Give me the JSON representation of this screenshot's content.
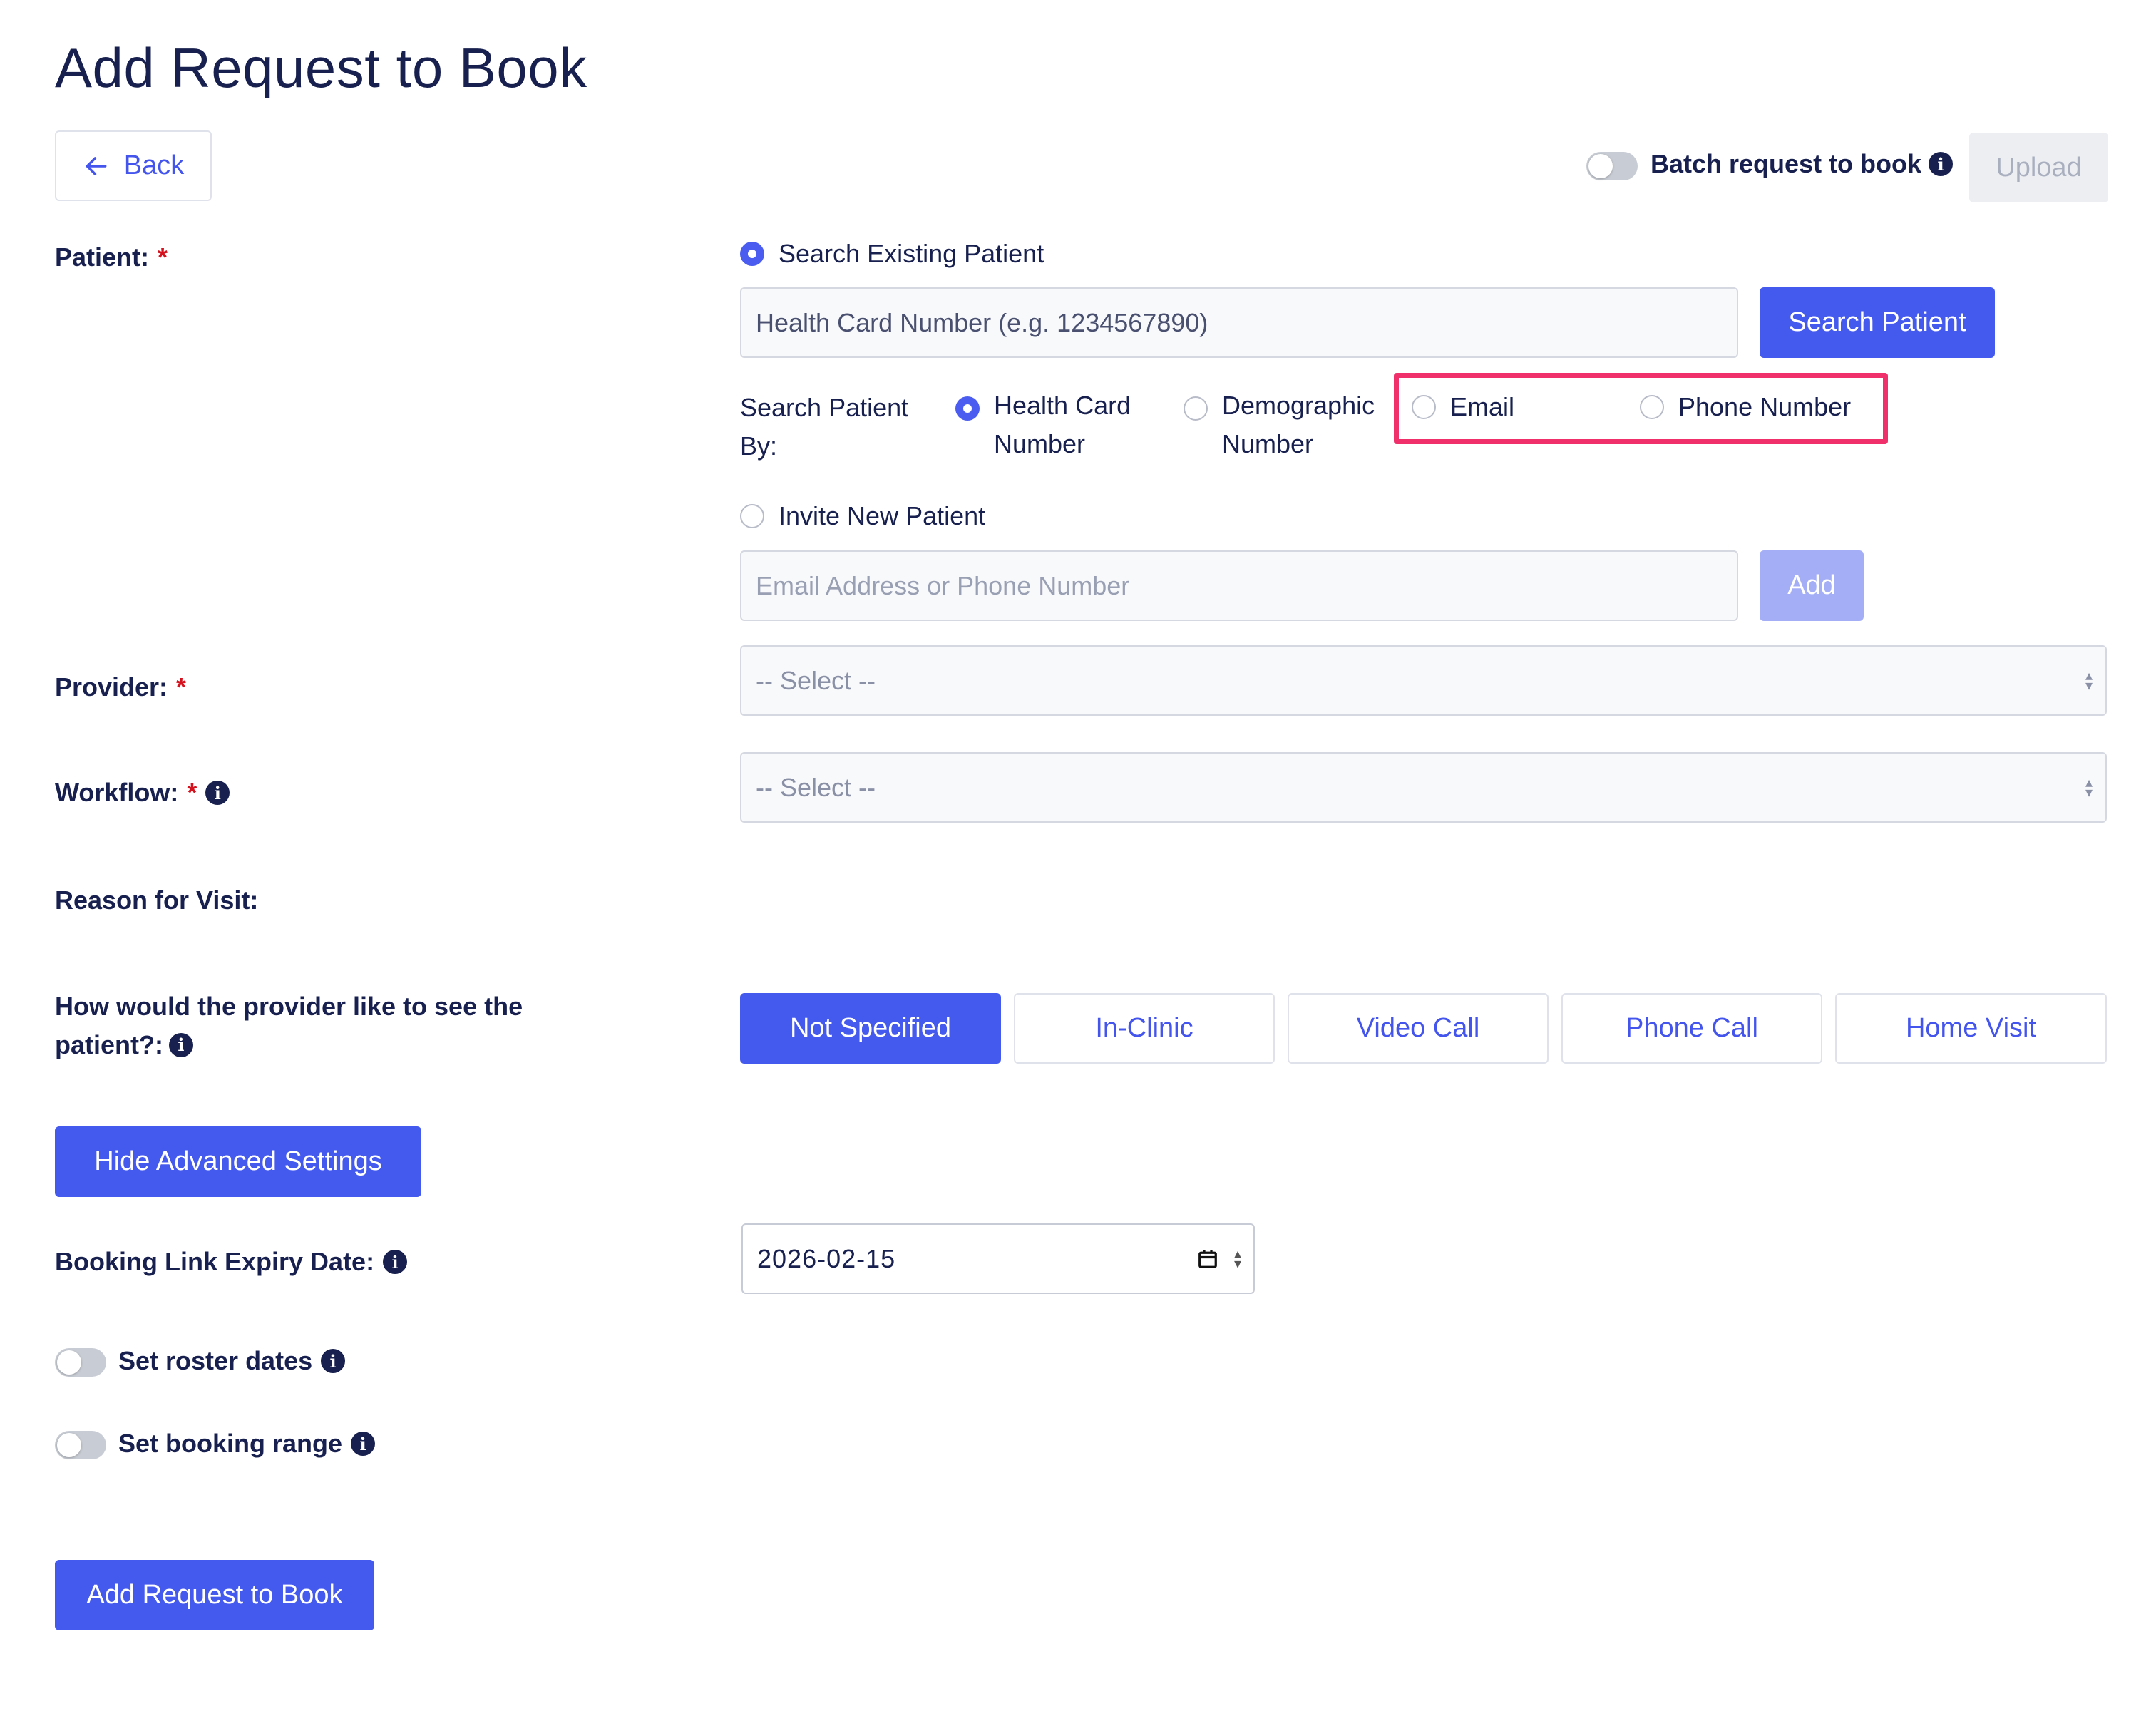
{
  "page": {
    "title": "Add Request to Book"
  },
  "header": {
    "back_label": "Back",
    "batch_label": "Batch request to book",
    "upload_label": "Upload"
  },
  "patient": {
    "label": "Patient:",
    "search_existing_label": "Search Existing Patient",
    "search_placeholder": "Health Card Number (e.g. 1234567890)",
    "search_button": "Search Patient",
    "search_by_label_line1": "Search Patient",
    "search_by_label_line2": "By:",
    "search_by_options": [
      {
        "line1": "Health Card",
        "line2": "Number",
        "checked": true
      },
      {
        "line1": "Demographic",
        "line2": "Number",
        "checked": false
      },
      {
        "line1": "Email",
        "line2": "",
        "checked": false
      },
      {
        "line1": "Phone Number",
        "line2": "",
        "checked": false
      }
    ],
    "invite_new_label": "Invite New Patient",
    "invite_placeholder": "Email Address or Phone Number",
    "add_button": "Add"
  },
  "provider": {
    "label": "Provider:",
    "value": "-- Select --"
  },
  "workflow": {
    "label": "Workflow:",
    "value": "-- Select --"
  },
  "reason": {
    "label": "Reason for Visit:"
  },
  "visit_mode": {
    "label_line1": "How would the provider like to see the",
    "label_line2": "patient?:",
    "options": [
      "Not Specified",
      "In-Clinic",
      "Video Call",
      "Phone Call",
      "Home Visit"
    ],
    "selected": "Not Specified"
  },
  "advanced": {
    "toggle_button": "Hide Advanced Settings"
  },
  "expiry": {
    "label": "Booking Link Expiry Date:",
    "value": "2026-02-15"
  },
  "roster": {
    "label": "Set roster dates"
  },
  "booking_range": {
    "label": "Set booking range"
  },
  "submit": {
    "label": "Add Request to Book"
  },
  "colors": {
    "primary": "#4459ee",
    "highlight": "#f0306a",
    "text": "#17204e",
    "required": "#d4121e"
  }
}
